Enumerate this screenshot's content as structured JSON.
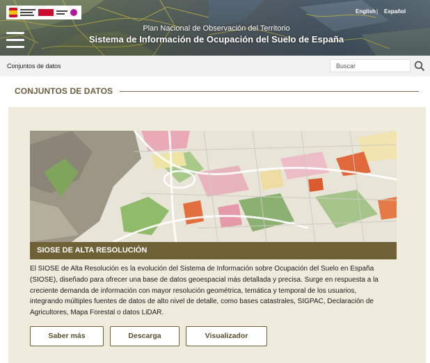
{
  "header": {
    "languages": {
      "english": "English",
      "separator": "|",
      "spanish": "Español"
    },
    "subtitle": "Plan Nacional de Observación del Territorio",
    "title": "Sistema de Información de Ocupación del Suelo de España"
  },
  "breadcrumb": {
    "current": "Conjuntos de datos"
  },
  "search": {
    "placeholder": "Buscar"
  },
  "section": {
    "title": "CONJUNTOS DE DATOS"
  },
  "dataset": {
    "caption": "SIOSE DE ALTA RESOLUCIÓN",
    "description_lines": [
      "El SIOSE de Alta Resolución es la evolución del Sistema de Información sobre Ocupación del Suelo en España",
      "(SIOSE), diseñado para ofrecer una base de datos geoespacial más detallada y precisa. Surge en respuesta a la",
      "creciente demanda de información con mayor resolución geométrica, temática y temporal de los usuarios,",
      "integrando múltiples fuentes de datos de alto nivel de detalle, como bases catastrales, SIGPAC, Declaración de",
      "Agricultores, Mapa Forestal o datos LiDAR."
    ],
    "buttons": {
      "more": "Saber más",
      "download": "Descarga",
      "viewer": "Visualizador"
    }
  },
  "colors": {
    "accent": "#6e6136",
    "heading": "#6b5d3d",
    "card_background": "#efebdd",
    "crumbbar": "#f2f2f2"
  },
  "icons": {
    "menu": "hamburger-icon",
    "search": "search-icon",
    "logo": "government-logo"
  }
}
